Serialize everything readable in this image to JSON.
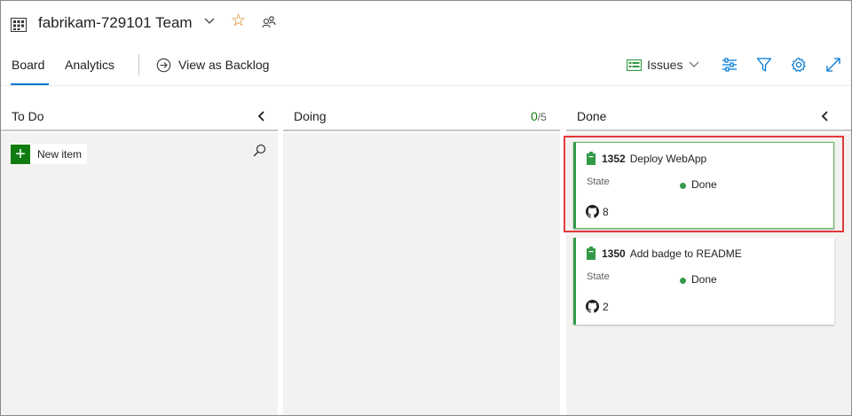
{
  "header": {
    "team_name": "fabrikam-729101 Team"
  },
  "tabs": {
    "board": "Board",
    "analytics": "Analytics",
    "view_as_backlog": "View as Backlog"
  },
  "toolbar": {
    "work_item_type": "Issues"
  },
  "columns": [
    {
      "title": "To Do",
      "new_item_label": "New item"
    },
    {
      "title": "Doing",
      "wip_count": "0",
      "wip_limit": "/5"
    },
    {
      "title": "Done"
    }
  ],
  "cards": [
    {
      "id": "1352",
      "title": "Deploy WebApp",
      "state_label": "State",
      "state": "Done",
      "github_links": "8"
    },
    {
      "id": "1350",
      "title": "Add badge to README",
      "state_label": "State",
      "state": "Done",
      "github_links": "2"
    }
  ],
  "colors": {
    "accent": "#0078d4",
    "done_green": "#339947",
    "highlight_red": "#e03a3a",
    "star_orange": "#d47500"
  }
}
